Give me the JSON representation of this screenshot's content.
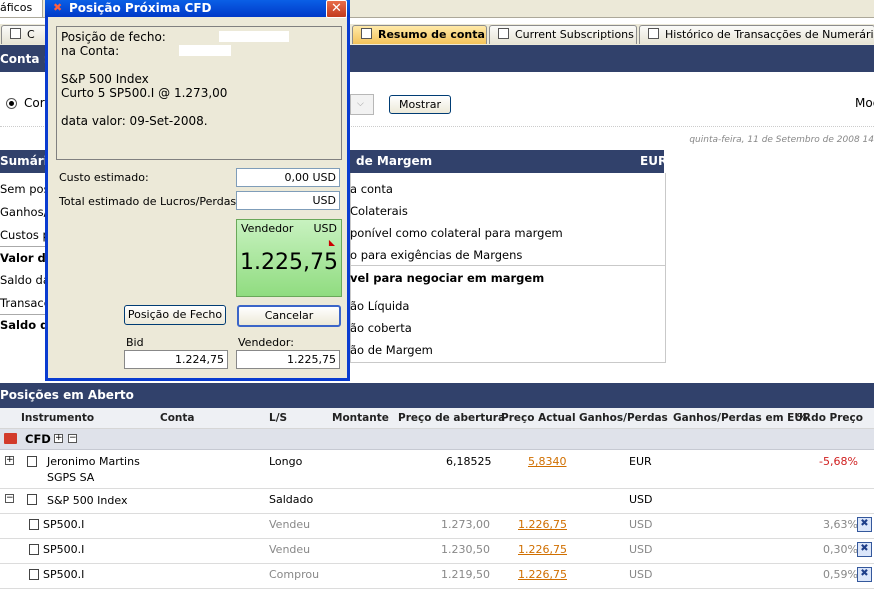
{
  "top_tab": {
    "label": "áficos"
  },
  "tabs": [
    {
      "label": "C",
      "active": false
    },
    {
      "label": "Resumo de conta",
      "active": true
    },
    {
      "label": "Current Subscriptions",
      "active": false
    },
    {
      "label": "Histórico de Transacções de Numerário",
      "active": false
    }
  ],
  "conta_bar": {
    "label": "Conta :"
  },
  "filter": {
    "radio_label": "Cor",
    "button": "Mostrar",
    "right_label": "Mod"
  },
  "date_text": "quinta-feira, 11 de Setembro de 2008 14",
  "summary": {
    "header": "Sumário",
    "margin_header": "de Margem",
    "currency": "EUR",
    "left_labels": [
      "Sem pos",
      "Ganhos/",
      "Custos p",
      "Valor de",
      "Saldo da",
      "Transacç",
      "Saldo da"
    ],
    "margin_lines": [
      "a conta",
      "Colaterais",
      "ponível como colateral para margem",
      "o para exigências de Margens",
      "vel para negociar em margem",
      "ão Líquida",
      "ão coberta",
      "ão de Margem"
    ]
  },
  "positions": {
    "header": "Posições em Aberto",
    "columns": [
      "Instrumento",
      "Conta",
      "L/S",
      "Montante",
      "Preço de abertura",
      "Preço Actual",
      "Ganhos/Perdas",
      "Ganhos/Perdas em EUR",
      "% do Preço"
    ],
    "group_label": "CFD",
    "rows": [
      {
        "instrument": "Jeronimo Martins",
        "instrument2": "SGPS SA",
        "ls": "Longo",
        "open": "6,18525",
        "current": "5,8340",
        "gl": "EUR",
        "pct": "-5,68%"
      },
      {
        "instrument": "S&P 500 Index",
        "ls": "Saldado",
        "gl": "USD"
      },
      {
        "instrument": "SP500.I",
        "ls": "Vendeu",
        "open": "1.273,00",
        "current": "1.226,75",
        "gl": "USD",
        "pct": "3,63%"
      },
      {
        "instrument": "SP500.I",
        "ls": "Vendeu",
        "open": "1.230,50",
        "current": "1.226,75",
        "gl": "USD",
        "pct": "0,30%"
      },
      {
        "instrument": "SP500.I",
        "ls": "Comprou",
        "open": "1.219,50",
        "current": "1.226,75",
        "gl": "USD",
        "pct": "0,59%"
      }
    ]
  },
  "dialog": {
    "title": "Posição Próxima CFD",
    "info_lines": [
      "Posição de fecho:",
      "na Conta:",
      "",
      "S&P 500 Index",
      "Curto 5 SP500.I @ 1.273,00",
      "",
      "data valor: 09-Set-2008."
    ],
    "custo_label": "Custo estimado:",
    "custo_value": "0,00 USD",
    "total_label": "Total estimado de Lucros/Perdas:",
    "total_value": "USD",
    "sell_label": "Vendedor",
    "sell_currency": "USD",
    "sell_price": "1.225,75",
    "close_button": "Posição de Fecho",
    "cancel_button": "Cancelar",
    "bid_label": "Bid",
    "bid_value": "1.224,75",
    "vend_label": "Vendedor:",
    "vend_value": "1.225,75"
  }
}
